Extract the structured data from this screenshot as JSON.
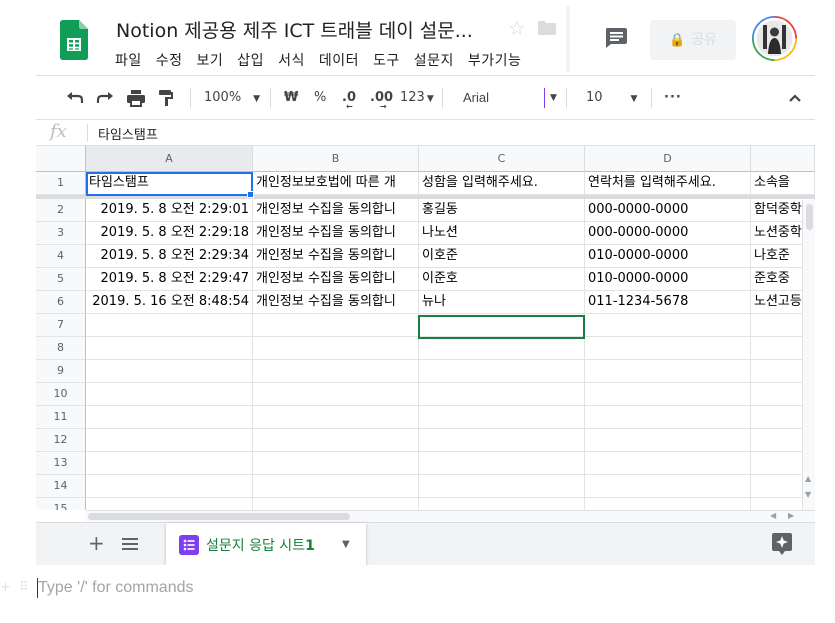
{
  "header": {
    "title": "Notion 제공용 제주 ICT 트래블 데이 설문...",
    "menu": [
      "파일",
      "수정",
      "보기",
      "삽입",
      "서식",
      "데이터",
      "도구",
      "설문지",
      "부가기능"
    ],
    "share_label": "공유"
  },
  "toolbar": {
    "zoom": "100%",
    "currency": "₩",
    "percent": "%",
    "dec_decrease": ".0",
    "dec_increase": ".00",
    "number_format": "123",
    "font": "Arial",
    "font_size": "10",
    "more": "···"
  },
  "formula_bar": {
    "fx": "fx",
    "value": "타임스탬프"
  },
  "columns": [
    "A",
    "B",
    "C",
    "D"
  ],
  "rows": [
    {
      "num": "1",
      "cells": [
        "타임스탬프",
        "개인정보보호법에 따른 개",
        "성함을 입력해주세요.",
        "연락처를 입력해주세요.",
        "소속을"
      ]
    },
    {
      "num": "2",
      "cells": [
        "2019. 5. 8 오전 2:29:01",
        "개인정보 수집을 동의합니",
        "홍길동",
        "000-0000-0000",
        "함덕중학"
      ]
    },
    {
      "num": "3",
      "cells": [
        "2019. 5. 8 오전 2:29:18",
        "개인정보 수집을 동의합니",
        "나노션",
        "000-0000-0000",
        "노션중학"
      ]
    },
    {
      "num": "4",
      "cells": [
        "2019. 5. 8 오전 2:29:34",
        "개인정보 수집을 동의합니",
        "이호준",
        "010-0000-0000",
        "나호준"
      ]
    },
    {
      "num": "5",
      "cells": [
        "2019. 5. 8 오전 2:29:47",
        "개인정보 수집을 동의합니",
        "이준호",
        "010-0000-0000",
        "준호중"
      ]
    },
    {
      "num": "6",
      "cells": [
        "2019. 5. 16 오전 8:48:54",
        "개인정보 수집을 동의합니",
        "뉴나",
        "011-1234-5678",
        "노션고등"
      ]
    },
    {
      "num": "7",
      "cells": [
        "",
        "",
        "",
        "",
        ""
      ]
    },
    {
      "num": "8",
      "cells": [
        "",
        "",
        "",
        "",
        ""
      ]
    },
    {
      "num": "9",
      "cells": [
        "",
        "",
        "",
        "",
        ""
      ]
    },
    {
      "num": "10",
      "cells": [
        "",
        "",
        "",
        "",
        ""
      ]
    },
    {
      "num": "11",
      "cells": [
        "",
        "",
        "",
        "",
        ""
      ]
    },
    {
      "num": "12",
      "cells": [
        "",
        "",
        "",
        "",
        ""
      ]
    },
    {
      "num": "13",
      "cells": [
        "",
        "",
        "",
        "",
        ""
      ]
    },
    {
      "num": "14",
      "cells": [
        "",
        "",
        "",
        "",
        ""
      ]
    },
    {
      "num": "15",
      "cells": [
        "",
        "",
        "",
        "",
        ""
      ]
    }
  ],
  "sheet_tab": {
    "label": "설문지 응답 시트",
    "number": "1"
  },
  "editor": {
    "placeholder": "Type '/' for commands"
  },
  "colors": {
    "sheets_green": "#0f9d58",
    "selection_blue": "#1a73e8",
    "active_green": "#188038",
    "forms_purple": "#7e3ff2"
  }
}
